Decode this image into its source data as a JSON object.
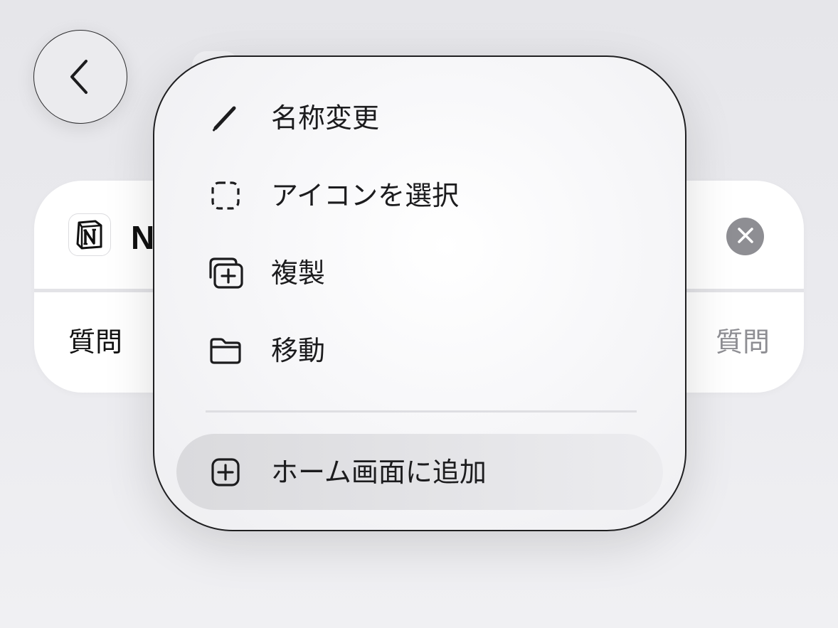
{
  "background_card": {
    "app_icon": "notion-icon",
    "title_visible": "N",
    "left_label": "質問",
    "right_label": "質問"
  },
  "navigation": {
    "back_icon": "chevron-left-icon"
  },
  "context_menu": {
    "items": [
      {
        "label": "名称変更",
        "icon": "pencil-icon"
      },
      {
        "label": "アイコンを選択",
        "icon": "dashed-square-icon"
      },
      {
        "label": "複製",
        "icon": "duplicate-icon"
      },
      {
        "label": "移動",
        "icon": "folder-icon"
      }
    ],
    "footer_item": {
      "label": "ホーム画面に追加",
      "icon": "plus-square-icon",
      "highlighted": true
    }
  },
  "colors": {
    "background": "#e8e8ec",
    "card": "#ffffff",
    "menu_text": "#1c1c1e",
    "secondary_text": "#8e8e93",
    "clear_button": "#8e8e93",
    "highlight": "#dcdce0"
  }
}
